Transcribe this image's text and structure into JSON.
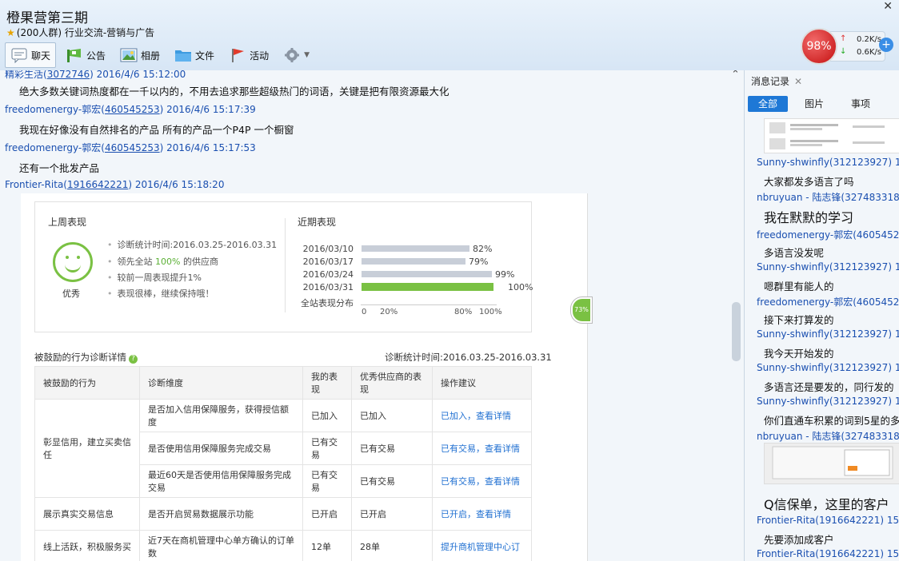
{
  "window": {
    "title": "橙果营第三期",
    "subtitle": "(200人群) 行业交流-营销与广告",
    "close_glyph": "✕"
  },
  "toolbar": {
    "chat": "聊天",
    "notice": "公告",
    "album": "相册",
    "files": "文件",
    "activity": "活动"
  },
  "speed": {
    "percent": "98%",
    "up": "0.2K/s",
    "down": "0.6K/s"
  },
  "chat": {
    "messages": [
      {
        "sender": "精彩生活",
        "qq": "3072746",
        "time": "2016/4/6 15:12:00",
        "text": "绝大多数关键词热度都在一千以内的，不用去追求那些超级热门的词语，关键是把有限资源最大化"
      },
      {
        "sender": "freedomenergy-郭宏",
        "qq": "460545253",
        "time": "2016/4/6 15:17:39",
        "text": "我现在好像没有自然排名的产品 所有的产品一个P4P  一个橱窗"
      },
      {
        "sender": "freedomenergy-郭宏",
        "qq": "460545253",
        "time": "2016/4/6 15:17:53",
        "text": "还有一个批发产品"
      },
      {
        "sender": "Frontier-Rita",
        "qq": "1916642221",
        "time": "2016/4/6 15:18:20",
        "text": ""
      }
    ]
  },
  "shot": {
    "last_week_title": "上周表现",
    "recent_title": "近期表现",
    "grade": "优秀",
    "bullets": [
      "诊断统计时间:2016.03.25-2016.03.31",
      "领先全站 100% 的供应商",
      "较前一周表现提升1%",
      "表现很棒，继续保持哦！"
    ],
    "bars": [
      {
        "label": "2016/03/10",
        "value": 82,
        "pct": "82%"
      },
      {
        "label": "2016/03/17",
        "value": 79,
        "pct": "79%"
      },
      {
        "label": "2016/03/24",
        "value": 99,
        "pct": "99%"
      },
      {
        "label": "2016/03/31",
        "value": 100,
        "pct": "100%"
      }
    ],
    "site_label": "全站表现分布",
    "ticks": [
      "0",
      "20%",
      "80%",
      "100%"
    ],
    "diag_title": "被鼓励的行为诊断详情",
    "diag_period": "诊断统计时间:2016.03.25-2016.03.31",
    "table_headers": [
      "被鼓励的行为",
      "诊断维度",
      "我的表现",
      "优秀供应商的表现",
      "操作建议"
    ],
    "rows": [
      {
        "cat": "彰显信用，建立买卖信任",
        "dim": "是否加入信用保障服务，获得授信额度",
        "mine": "已加入",
        "best": "已加入",
        "act": "已加入，查看详情"
      },
      {
        "cat": "",
        "dim": "是否使用信用保障服务完成交易",
        "mine": "已有交易",
        "best": "已有交易",
        "act": "已有交易，查看详情"
      },
      {
        "cat": "",
        "dim": "最近60天是否使用信用保障服务完成交易",
        "mine": "已有交易",
        "best": "已有交易",
        "act": "已有交易，查看详情"
      },
      {
        "cat": "展示真实交易信息",
        "dim": "是否开启贸易数据展示功能",
        "mine": "已开启",
        "best": "已开启",
        "act": "已开启，查看详情"
      },
      {
        "cat": "线上活跃，积极服务买",
        "dim": "近7天在商机管理中心单方确认的订单数",
        "mine": "12单",
        "best": "28单",
        "act": "提升商机管理中心订"
      }
    ],
    "badge": "73%"
  },
  "side": {
    "tab": "消息记录",
    "filters": [
      "全部",
      "图片",
      "事项"
    ],
    "entries": [
      {
        "head": "Sunny-shwinfly(312123927) 15:4",
        "body": "大家都发多语言了吗",
        "big": false
      },
      {
        "head": "nbruyuan - 陆志锋(327483318) 1",
        "body": "我在默默的学习",
        "big": true
      },
      {
        "head": "freedomenergy-郭宏(460545253",
        "body": "多语言没发呢",
        "big": false
      },
      {
        "head": "Sunny-shwinfly(312123927) 15:4",
        "body": "嗯群里有能人的",
        "big": false
      },
      {
        "head": "freedomenergy-郭宏(460545253",
        "body": "接下来打算发的",
        "big": false
      },
      {
        "head": "Sunny-shwinfly(312123927) 15:4",
        "body": "我今天开始发的",
        "big": false
      },
      {
        "head": "Sunny-shwinfly(312123927) 15:4",
        "body": "多语言还是要发的，同行发的",
        "big": false
      },
      {
        "head": "Sunny-shwinfly(312123927) 15:4",
        "body": "你们直通车积累的词到5星的多",
        "big": false
      },
      {
        "head": "nbruyuan - 陆志锋(327483318) 1",
        "body": "",
        "big": false
      },
      {
        "head": "",
        "body": "Q信保单，这里的客户",
        "big": true
      },
      {
        "head": "Frontier-Rita(1916642221) 15:55",
        "body": "先要添加成客户",
        "big": false
      },
      {
        "head": "Frontier-Rita(1916642221) 15:56",
        "body": "",
        "big": false
      }
    ]
  }
}
